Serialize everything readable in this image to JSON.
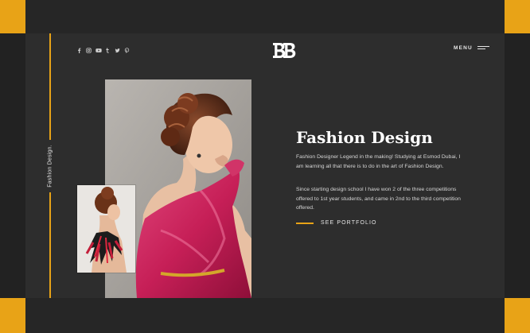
{
  "sidebar": {
    "vertical_label": "Fashion Design."
  },
  "header": {
    "social_icons": [
      "facebook-icon",
      "instagram-icon",
      "youtube-icon",
      "tumblr-icon",
      "twitter-icon",
      "pinterest-icon"
    ],
    "logo_text": "BB",
    "menu_label": "MENU"
  },
  "main": {
    "title": "Fashion Design",
    "paragraph_1": "Fashion Designer Legend in the making! Studying at Esmod Dubai, I am learning all that there is to do in the art of Fashion Design.",
    "paragraph_2": "Since starting design school I have won 2 of the three competitions offered to 1st year students, and came in 2nd  to the third competition offered.",
    "cta_label": "SEE PORTFOLIO"
  },
  "colors": {
    "accent": "#e8a317",
    "background": "#2d2d2d",
    "text": "#ffffff"
  }
}
